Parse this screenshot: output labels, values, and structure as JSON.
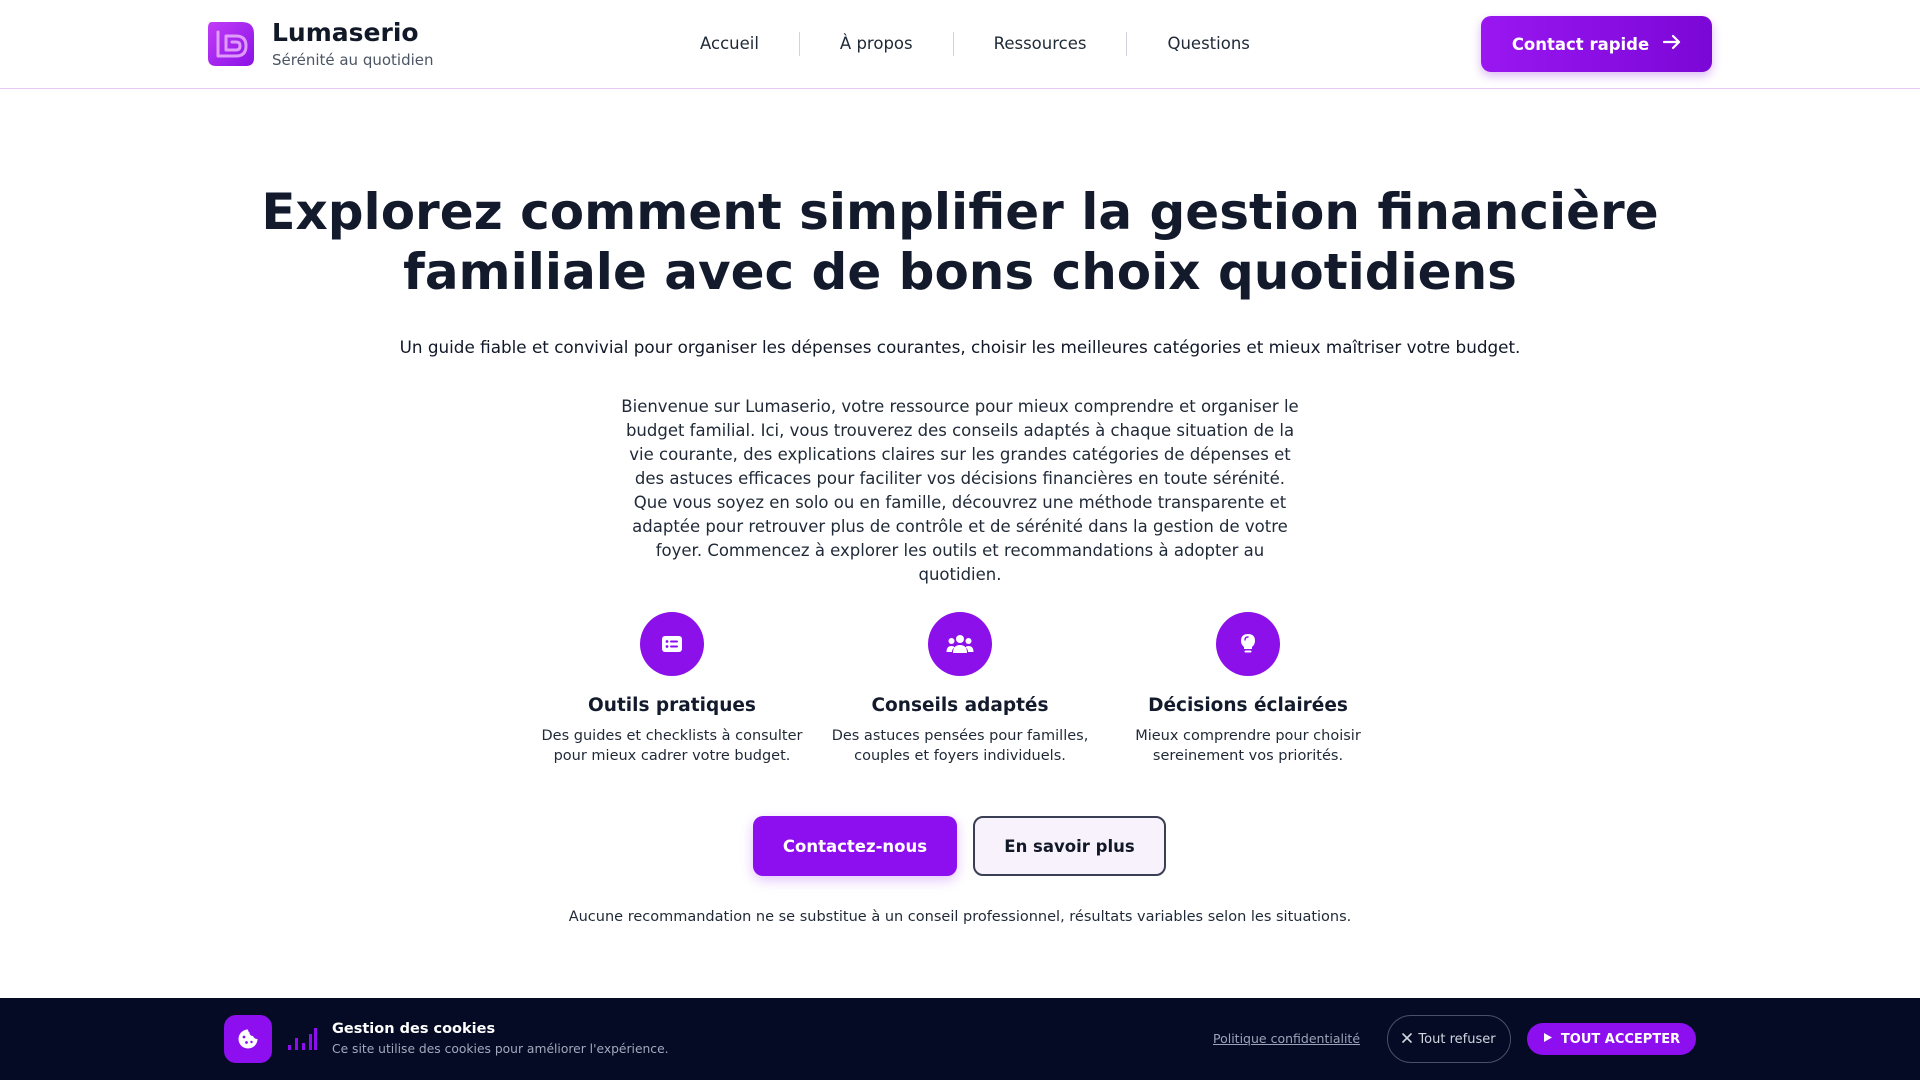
{
  "header": {
    "brand_name": "Lumaserio",
    "brand_tagline": "Sérénité au quotidien",
    "nav": [
      "Accueil",
      "À propos",
      "Ressources",
      "Questions"
    ],
    "cta_label": "Contact rapide"
  },
  "hero": {
    "title_line1": "Explorez comment simplifier la gestion financière",
    "title_line2": "familiale avec de bons choix quotidiens",
    "subtitle": "Un guide fiable et convivial pour organiser les dépenses courantes, choisir les meilleures catégories et mieux maîtriser votre budget.",
    "intro": "Bienvenue sur Lumaserio, votre ressource pour mieux comprendre et organiser le budget familial. Ici, vous trouverez des conseils adaptés à chaque situation de la vie courante, des explications claires sur les grandes catégories de dépenses et des astuces efficaces pour faciliter vos décisions financières en toute sérénité. Que vous soyez en solo ou en famille, découvrez une méthode transparente et adaptée pour retrouver plus de contrôle et de sérénité dans la gestion de votre foyer. Commencez à explorer les outils et recommandations à adopter au quotidien."
  },
  "features": [
    {
      "icon": "checklist-card-icon",
      "title": "Outils pratiques",
      "desc": "Des guides et checklists à consulter pour mieux cadrer votre budget."
    },
    {
      "icon": "people-group-icon",
      "title": "Conseils adaptés",
      "desc": "Des astuces pensées pour familles, couples et foyers individuels."
    },
    {
      "icon": "lightbulb-icon",
      "title": "Décisions éclairées",
      "desc": "Mieux comprendre pour choisir sereinement vos priorités."
    }
  ],
  "actions": {
    "primary": "Contactez-nous",
    "secondary": "En savoir plus"
  },
  "disclaimer": "Aucune recommandation ne se substitue à un conseil professionnel, résultats variables selon les situations.",
  "cookie": {
    "title": "Gestion des cookies",
    "text": "Ce site utilise des cookies pour améliorer l'expérience.",
    "policy_label": "Politique confidentialité",
    "refuse_label": "Tout refuser",
    "accept_label": "TOUT ACCEPTER"
  },
  "colors": {
    "accent": "#8d0ff0",
    "cookie_bg": "#050b24",
    "heading": "#121a2c"
  }
}
